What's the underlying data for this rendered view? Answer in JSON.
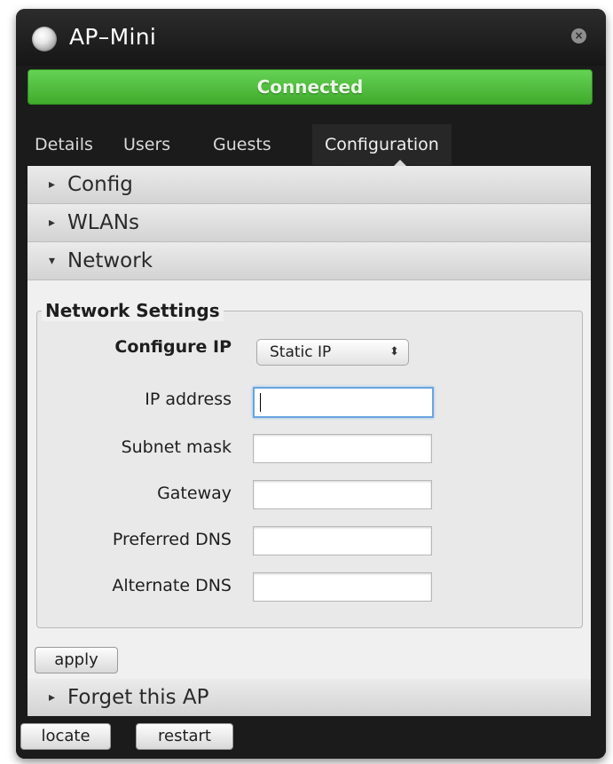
{
  "window": {
    "title": "AP–Mini",
    "close_glyph": "×",
    "status": "Connected",
    "status_color": "#4cbf3a"
  },
  "tabs": [
    {
      "label": "Details",
      "active": false
    },
    {
      "label": "Users",
      "active": false
    },
    {
      "label": "Guests",
      "active": false
    },
    {
      "label": "Configuration",
      "active": true
    }
  ],
  "sections": {
    "config": {
      "label": "Config",
      "arrow": "▸"
    },
    "wlans": {
      "label": "WLANs",
      "arrow": "▸"
    },
    "network": {
      "label": "Network",
      "arrow": "▾"
    },
    "forget": {
      "label": "Forget this AP",
      "arrow": "▸"
    }
  },
  "network_settings": {
    "legend": "Network Settings",
    "configure_ip_label": "Configure IP",
    "configure_ip_value": "Static IP",
    "select_caret": "⬍",
    "fields": [
      {
        "label": "IP address",
        "value": "",
        "focused": true
      },
      {
        "label": "Subnet mask",
        "value": ""
      },
      {
        "label": "Gateway",
        "value": ""
      },
      {
        "label": "Preferred DNS",
        "value": ""
      },
      {
        "label": "Alternate DNS",
        "value": ""
      }
    ]
  },
  "buttons": {
    "apply": "apply",
    "locate": "locate",
    "restart": "restart"
  },
  "icons": {
    "status_dot": "status-dot-icon",
    "close": "close-icon",
    "collapsed_arrow": "chevron-right-icon",
    "expanded_arrow": "chevron-down-icon",
    "select_arrows": "up-down-arrows-icon"
  }
}
